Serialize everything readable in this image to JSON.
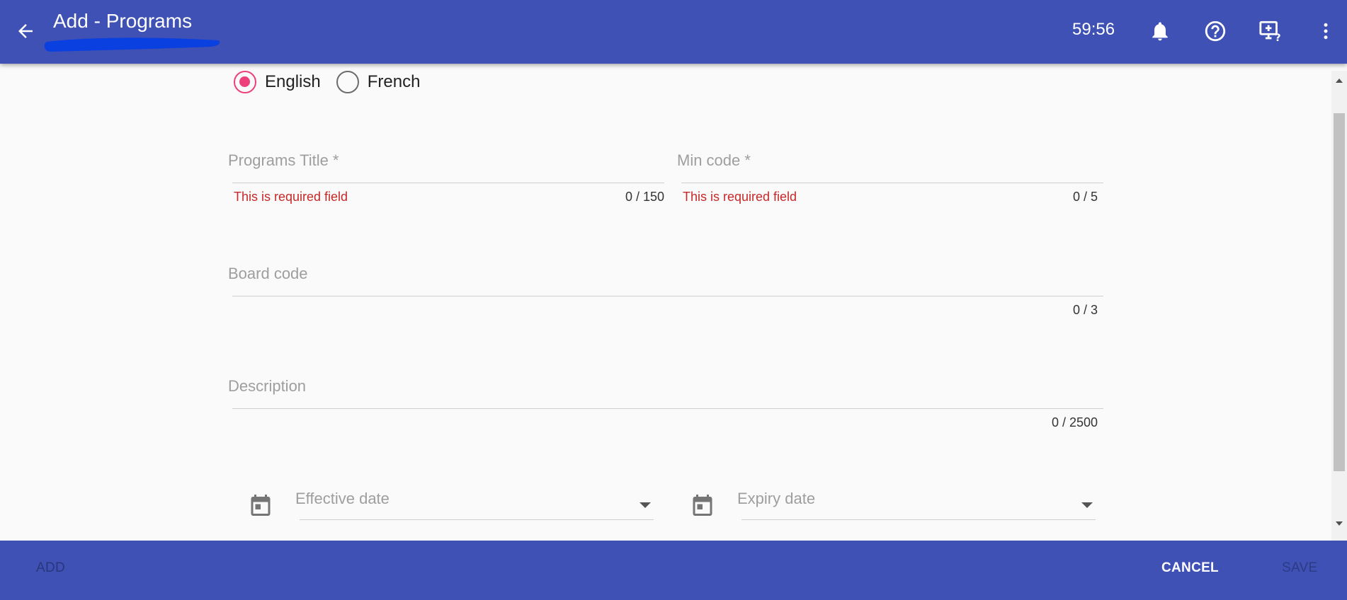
{
  "header": {
    "title": "Add - Programs",
    "timer": "59:56"
  },
  "language": {
    "options": [
      "English",
      "French"
    ],
    "selected": "English"
  },
  "form": {
    "programs_title": {
      "label": "Programs Title *",
      "error": "This is required field",
      "counter": "0 / 150"
    },
    "min_code": {
      "label": "Min code *",
      "error": "This is required field",
      "counter": "0 / 5"
    },
    "board_code": {
      "label": "Board code",
      "counter": "0 / 3"
    },
    "description": {
      "label": "Description",
      "counter": "0 / 2500"
    },
    "effective_date": {
      "label": "Effective date"
    },
    "expiry_date": {
      "label": "Expiry date"
    }
  },
  "footer": {
    "add_label": "ADD",
    "cancel_label": "CANCEL",
    "save_label": "SAVE"
  },
  "icons": {
    "back": "arrow-back-icon",
    "notifications": "bell-icon",
    "help": "help-circle-icon",
    "screen_help": "monitor-question-icon",
    "menu": "more-vert-icon",
    "calendar": "calendar-icon"
  },
  "colors": {
    "primary": "#3f51b5",
    "accent": "#ec407a",
    "error": "#c62828",
    "scribble": "#0a3fe0"
  }
}
